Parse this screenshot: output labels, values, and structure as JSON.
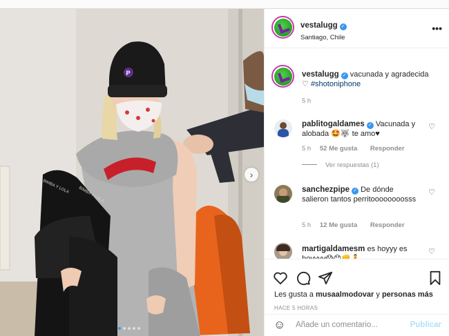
{
  "post": {
    "username": "vestalugg",
    "location": "Santiago, Chile",
    "more": "•••",
    "caption_text": "vacunada y agradecida",
    "caption_tag": "#shotoniphone",
    "caption_time": "5 h"
  },
  "photo": {
    "hat_letter": "P",
    "jacket_text_1": "BIMBA Y LOLA",
    "jacket_text_2": "BIMBA Y LOLA",
    "next_icon": "chevron-right-icon",
    "slide_count": 5,
    "active_slide": 1
  },
  "comments": [
    {
      "username": "pablitogaldames",
      "verified": true,
      "text": "Vacunada y alobada 🤩🐺 te amo♥",
      "time": "5 h",
      "likes": "52 Me gusta",
      "reply": "Responder",
      "view_replies": "Ver respuestas (1)"
    },
    {
      "username": "sanchezpipe",
      "verified": true,
      "text": "De dónde salieron tantos perritoooooooosss",
      "time": "5 h",
      "likes": "12 Me gusta",
      "reply": "Responder"
    },
    {
      "username": "martigaldamesm",
      "verified": false,
      "text": "es hoyyy es hoyyyy😱😯👊🧍"
    }
  ],
  "actions": {
    "icons": [
      "heart-icon",
      "comment-icon",
      "share-icon",
      "bookmark-icon"
    ],
    "likes_prefix": "Les gusta a",
    "likes_user": "musaalmodovar",
    "likes_and": "y",
    "likes_more": "personas más",
    "timestamp": "HACE 5 HORAS"
  },
  "add_comment": {
    "placeholder": "Añade un comentario...",
    "publish": "Publicar",
    "emoji_icon": "smiley-icon"
  },
  "colors": {
    "verified": "#3897f0",
    "link": "#00376b",
    "muted": "#8e8e8e",
    "publish_disabled": "#b2dffc"
  }
}
